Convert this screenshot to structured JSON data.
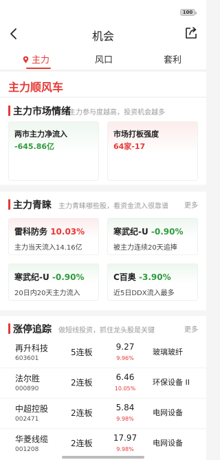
{
  "status": {
    "battery": "100"
  },
  "nav": {
    "title": "机会"
  },
  "tabs": [
    {
      "label": "主力"
    },
    {
      "label": "风口"
    },
    {
      "label": "套利"
    }
  ],
  "hero": {
    "title": "主力顺风车"
  },
  "market": {
    "title": "主力市场情绪",
    "subtitle": "主力参与度越高，投资机会越多",
    "cards": [
      {
        "label": "两市主力净流入",
        "value": "-645.86亿"
      },
      {
        "label": "市场打板强度",
        "value": "64家-17"
      }
    ]
  },
  "qingtai": {
    "title": "主力青睐",
    "subtitle": "主力青睐哪些股，看资金流入很靠谱",
    "more": "更多",
    "cards": [
      {
        "name": "雷科防务",
        "pct": "10.03%",
        "desc": "主力当天流入14.16亿",
        "tone": "up"
      },
      {
        "name": "寒武纪-U",
        "pct": "-0.90%",
        "desc": "被主力连续20天追捧",
        "tone": "down"
      },
      {
        "name": "寒武纪-U",
        "pct": "-0.90%",
        "desc": "20日内20天主力流入",
        "tone": "down"
      },
      {
        "name": "C百奥",
        "pct": "-3.90%",
        "desc": "近5日DDX流入最多",
        "tone": "down"
      }
    ]
  },
  "limitup": {
    "title": "涨停追踪",
    "subtitle": "做短线投资，抓住龙头股是关键",
    "more": "更多",
    "rows": [
      {
        "name": "再升科技",
        "code": "603601",
        "board": "5连板",
        "price": "9.27",
        "pct": "9.96%",
        "sector": "玻璃玻纤"
      },
      {
        "name": "法尔胜",
        "code": "000890",
        "board": "2连板",
        "price": "6.46",
        "pct": "10.05%",
        "sector": "环保设备 II"
      },
      {
        "name": "中超控股",
        "code": "002471",
        "board": "2连板",
        "price": "5.84",
        "pct": "9.98%",
        "sector": "电网设备"
      },
      {
        "name": "华菱线缆",
        "code": "001208",
        "board": "2连板",
        "price": "17.97",
        "pct": "9.98%",
        "sector": "电网设备"
      }
    ]
  },
  "colors": {
    "accent": "#e53935",
    "up": "#e53935",
    "down": "#2e9b3e"
  }
}
